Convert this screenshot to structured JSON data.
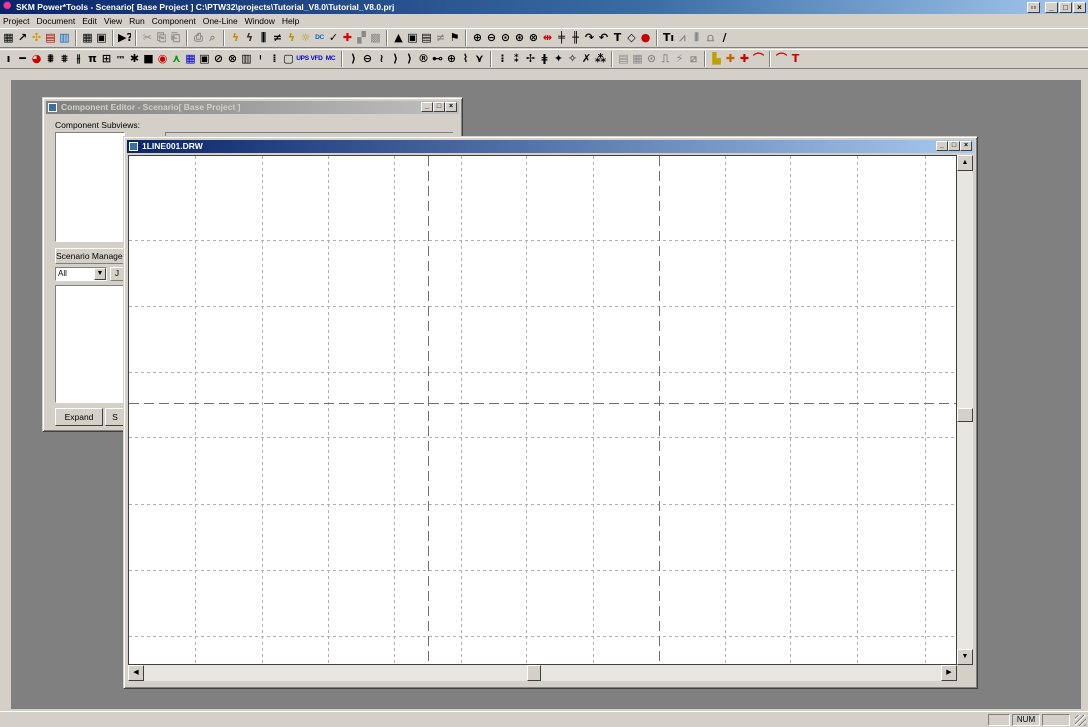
{
  "app": {
    "title": "SKM Power*Tools - Scenario[ Base Project ] C:\\PTW32\\projects\\Tutorial_V8.0\\Tutorial_V8.0.prj",
    "app_icon": "skm-star-icon",
    "window_buttons": [
      "restore-child",
      "minimize",
      "restore",
      "close"
    ]
  },
  "menu": [
    "Project",
    "Document",
    "Edit",
    "View",
    "Run",
    "Component",
    "One-Line",
    "Window",
    "Help"
  ],
  "toolbar1": {
    "groups": [
      [
        {
          "g": "▦",
          "c": "#000"
        },
        {
          "g": "↗",
          "c": "#000"
        },
        {
          "g": "✣",
          "c": "#c8a000"
        },
        {
          "g": "▤",
          "c": "#a00"
        },
        {
          "g": "▥",
          "c": "#06c"
        }
      ],
      [
        {
          "g": "▦",
          "c": "#000"
        },
        {
          "g": "▣",
          "c": "#000"
        }
      ],
      [
        {
          "g": "▶?",
          "c": "#000"
        }
      ],
      [
        {
          "g": "✂",
          "c": "#888"
        },
        {
          "g": "⎘",
          "c": "#888"
        },
        {
          "g": "⎗",
          "c": "#888"
        }
      ],
      [
        {
          "g": "⎙",
          "c": "#888"
        },
        {
          "g": "⌕",
          "c": "#888"
        }
      ],
      [
        {
          "g": "ϟ",
          "c": "#c09000"
        },
        {
          "g": "ϟ",
          "c": "#333"
        },
        {
          "g": "⫼",
          "c": "#000"
        },
        {
          "g": "≠",
          "c": "#000"
        },
        {
          "g": "ϟ",
          "c": "#c09000"
        },
        {
          "g": "☼",
          "c": "#c09000"
        },
        {
          "g": "DC",
          "c": "#06c",
          "t": true
        },
        {
          "g": "✓",
          "c": "#000"
        },
        {
          "g": "✚",
          "c": "#d00"
        },
        {
          "g": "▞",
          "c": "#888"
        },
        {
          "g": "▩",
          "c": "#888"
        }
      ],
      [
        {
          "g": "▲",
          "c": "#000"
        },
        {
          "g": "▣",
          "c": "#000"
        },
        {
          "g": "▤",
          "c": "#000"
        },
        {
          "g": "≠",
          "c": "#888"
        },
        {
          "g": "⚑",
          "c": "#000"
        }
      ],
      [
        {
          "g": "⊕",
          "c": "#000"
        },
        {
          "g": "⊖",
          "c": "#000"
        },
        {
          "g": "⊙",
          "c": "#000"
        },
        {
          "g": "⊛",
          "c": "#000"
        },
        {
          "g": "⊗",
          "c": "#000"
        },
        {
          "g": "⇹",
          "c": "#c00"
        },
        {
          "g": "╪",
          "c": "#000"
        },
        {
          "g": "╫",
          "c": "#000"
        },
        {
          "g": "↷",
          "c": "#000"
        },
        {
          "g": "↶",
          "c": "#000"
        },
        {
          "g": "T",
          "c": "#000"
        },
        {
          "g": "◇",
          "c": "#000"
        },
        {
          "g": "●",
          "c": "#c00"
        }
      ],
      [
        {
          "g": "Tı",
          "c": "#000"
        },
        {
          "g": "⩘",
          "c": "#888"
        },
        {
          "g": "⫴",
          "c": "#888"
        },
        {
          "g": "⩍",
          "c": "#888"
        },
        {
          "g": "∕",
          "c": "#000"
        }
      ]
    ]
  },
  "toolbar2": {
    "groups": [
      [
        {
          "g": "ı",
          "c": "#000"
        },
        {
          "g": "━",
          "c": "#000"
        },
        {
          "g": "◕",
          "c": "#c00"
        },
        {
          "g": "⩩",
          "c": "#000"
        },
        {
          "g": "⩨",
          "c": "#000"
        },
        {
          "g": "⫲",
          "c": "#000"
        },
        {
          "g": "π",
          "c": "#000"
        },
        {
          "g": "⊞",
          "c": "#000"
        },
        {
          "g": "ᵐᵐ",
          "c": "#000",
          "t": true
        },
        {
          "g": "✱",
          "c": "#000"
        },
        {
          "g": "■",
          "c": "#000"
        },
        {
          "g": "◉",
          "c": "#c00"
        },
        {
          "g": "⋏",
          "c": "#090"
        },
        {
          "g": "▦",
          "c": "#00c"
        },
        {
          "g": "▣",
          "c": "#000"
        },
        {
          "g": "⊘",
          "c": "#000"
        },
        {
          "g": "⊗",
          "c": "#000"
        },
        {
          "g": "▥",
          "c": "#000"
        },
        {
          "g": "ᵎ",
          "c": "#000"
        },
        {
          "g": "⁞",
          "c": "#000"
        },
        {
          "g": "▢",
          "c": "#000"
        },
        {
          "g": "UPS",
          "c": "#00c",
          "t": true
        },
        {
          "g": "VFD",
          "c": "#00c",
          "t": true
        },
        {
          "g": "MC",
          "c": "#00c",
          "t": true
        }
      ],
      [
        {
          "g": "⟩",
          "c": "#000"
        },
        {
          "g": "⊖",
          "c": "#000"
        },
        {
          "g": "≀",
          "c": "#000"
        },
        {
          "g": "⟩",
          "c": "#000"
        },
        {
          "g": "⟩",
          "c": "#000"
        },
        {
          "g": "®",
          "c": "#000"
        },
        {
          "g": "⊷",
          "c": "#000"
        },
        {
          "g": "⊕",
          "c": "#000"
        },
        {
          "g": "⌇",
          "c": "#000"
        },
        {
          "g": "⋎",
          "c": "#000"
        }
      ],
      [
        {
          "g": "⁝",
          "c": "#000"
        },
        {
          "g": "⁑",
          "c": "#000"
        },
        {
          "g": "✢",
          "c": "#000"
        },
        {
          "g": "ǂ",
          "c": "#000"
        },
        {
          "g": "✦",
          "c": "#000"
        },
        {
          "g": "✧",
          "c": "#000"
        },
        {
          "g": "✗",
          "c": "#000"
        },
        {
          "g": "⁂",
          "c": "#000"
        }
      ],
      [
        {
          "g": "▤",
          "c": "#888"
        },
        {
          "g": "▦",
          "c": "#888"
        },
        {
          "g": "⊙",
          "c": "#888"
        },
        {
          "g": "⎍",
          "c": "#888"
        },
        {
          "g": "⚡",
          "c": "#888"
        },
        {
          "g": "⧄",
          "c": "#888"
        }
      ],
      [
        {
          "g": "▙",
          "c": "#c0a000"
        },
        {
          "g": "✚",
          "c": "#c06000"
        },
        {
          "g": "✚",
          "c": "#c00"
        },
        {
          "g": "⌒",
          "c": "#c00"
        }
      ],
      [
        {
          "g": "⌒",
          "c": "#c00"
        },
        {
          "g": "T",
          "c": "#c00"
        }
      ]
    ]
  },
  "component_editor": {
    "title": "Component Editor - Scenario[ Base Project ]",
    "subviews_label": "Component Subviews:",
    "scenario_tab_label": "Scenario Manager",
    "filter_value": "All",
    "small_button_label": "J",
    "expand_label": "Expand",
    "second_button_label": "S"
  },
  "drawing_window": {
    "title": "1LINE001.DRW"
  },
  "status": {
    "num": "NUM"
  }
}
